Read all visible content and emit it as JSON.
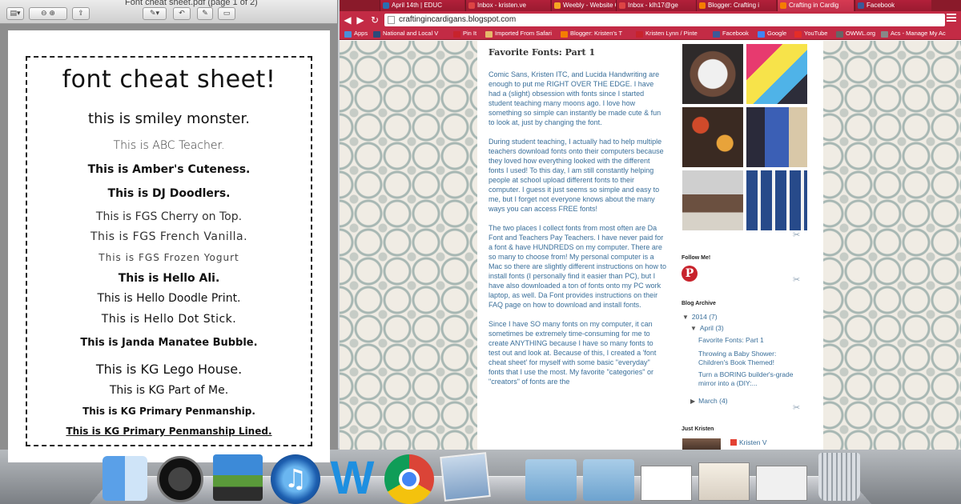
{
  "preview": {
    "title": "Font cheat sheet.pdf (page 1 of 2)",
    "sheet_title": "font cheat sheet!",
    "lines": [
      "this is smiley monster.",
      "This is ABC Teacher.",
      "This is Amber's Cuteness.",
      "This is DJ Doodlers.",
      "This is FGS Cherry on Top.",
      "This is FGS French Vanilla.",
      "This is FGS Frozen Yogurt",
      "This is Hello Ali.",
      "This is Hello Doodle Print.",
      "This is Hello Dot Stick.",
      "This is Janda Manatee Bubble.",
      "This is KG Lego House.",
      "This is KG Part of Me.",
      "This is KG Primary Penmanship.",
      "This is KG Primary Penmanship Lined."
    ]
  },
  "chrome": {
    "tabs": [
      {
        "label": "April 14th | EDUC",
        "icon_color": "#2a6fb0"
      },
      {
        "label": "Inbox - kristen.ve",
        "icon_color": "#d44"
      },
      {
        "label": "Weebly - Website C",
        "icon_color": "#f5a623"
      },
      {
        "label": "Inbox - klh17@ge",
        "icon_color": "#d44"
      },
      {
        "label": "Blogger: Crafting i",
        "icon_color": "#f57d00"
      },
      {
        "label": "Crafting in Cardig",
        "icon_color": "#f57d00"
      },
      {
        "label": "Facebook",
        "icon_color": "#3b5998"
      }
    ],
    "url": "craftingincardigans.blogspot.com",
    "bookmarks": [
      {
        "label": "Apps",
        "icon_color": "#4a90d9"
      },
      {
        "label": "National and Local V",
        "icon_color": "#2b4a7a"
      },
      {
        "label": "Pin It",
        "icon_color": "#c8232c"
      },
      {
        "label": "Imported From Safari",
        "icon_color": "#e6b86a"
      },
      {
        "label": "Blogger: Kristen's T",
        "icon_color": "#f57d00"
      },
      {
        "label": "Kristen Lynn / Pinte",
        "icon_color": "#c8232c"
      },
      {
        "label": "Facebook",
        "icon_color": "#3b5998"
      },
      {
        "label": "Google",
        "icon_color": "#4285f4"
      },
      {
        "label": "YouTube",
        "icon_color": "#e52d27"
      },
      {
        "label": "OWWL.org",
        "icon_color": "#666"
      },
      {
        "label": "Acs - Manage My Ac",
        "icon_color": "#888"
      }
    ]
  },
  "blog": {
    "post_title": "Favorite Fonts: Part 1",
    "paragraphs": [
      "Comic Sans, Kristen ITC, and Lucida Handwriting are enough to put me RIGHT OVER THE EDGE. I have had a (slight) obsession with fonts since I started student teaching many moons ago. I love how something so simple can instantly be made cute & fun to look at, just by changing the font.",
      "During student teaching, I actually had to help multiple teachers download fonts onto their computers because they loved how everything looked with the different fonts I used! To this day, I am still constantly helping people at school upload different fonts to their computer. I guess it just seems so simple and easy to me, but I forget not everyone knows about the many ways you can access FREE fonts!",
      "The two places I collect fonts from most often are Da Font and Teachers Pay Teachers. I have never paid for a font & have HUNDREDS on my computer. There are so many to choose from! My personal computer is a Mac so there are slightly different instructions on how to install fonts (I personally find it easier than PC), but I have also downloaded a ton of fonts onto my PC work laptop, as well. Da Font provides instructions on their FAQ page on how to download and install fonts.",
      "Since I have SO many fonts on my computer, it can sometimes be extremely time-consuming for me to create ANYTHING because I have so many fonts to test out and look at. Because of this, I created a 'font cheat sheet' for myself with some basic \"everyday\" fonts that I use the most. My favorite \"categories\" or \"creators\" of fonts are the"
    ],
    "follow_label": "Follow Me!",
    "archive_label": "Blog Archive",
    "archive": {
      "year": "2014",
      "year_count": "(7)",
      "month": "April",
      "month_count": "(3)",
      "posts": [
        "Favorite Fonts: Part 1",
        "Throwing a Baby Shower: Children's Book Themed!",
        "Turn a BORING builder's-grade mirror into a (DIY:..."
      ],
      "month2": "March",
      "month2_count": "(4)"
    },
    "just_label": "Just Kristen",
    "profile_name": "Kristen V"
  },
  "dock": {
    "items": [
      "finder-icon",
      "dashboard-icon",
      "iphoto-icon",
      "itunes-icon",
      "weebly-icon",
      "chrome-icon",
      "preview-icon",
      "applications-folder-icon",
      "documents-folder-icon",
      "window-thumbnail-icon",
      "window-thumbnail-icon",
      "window-thumbnail-icon",
      "trash-icon"
    ]
  }
}
